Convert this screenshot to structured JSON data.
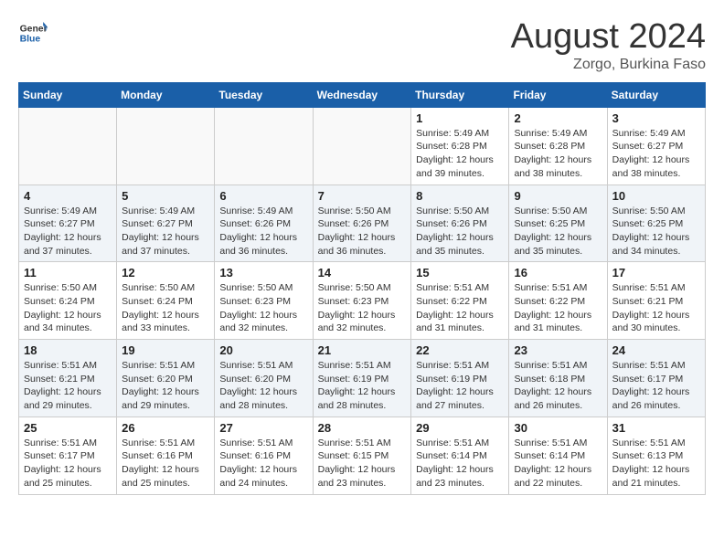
{
  "header": {
    "logo_line1": "General",
    "logo_line2": "Blue",
    "title": "August 2024",
    "location": "Zorgo, Burkina Faso"
  },
  "days_of_week": [
    "Sunday",
    "Monday",
    "Tuesday",
    "Wednesday",
    "Thursday",
    "Friday",
    "Saturday"
  ],
  "weeks": [
    [
      {
        "day": "",
        "info": ""
      },
      {
        "day": "",
        "info": ""
      },
      {
        "day": "",
        "info": ""
      },
      {
        "day": "",
        "info": ""
      },
      {
        "day": "1",
        "info": "Sunrise: 5:49 AM\nSunset: 6:28 PM\nDaylight: 12 hours\nand 39 minutes."
      },
      {
        "day": "2",
        "info": "Sunrise: 5:49 AM\nSunset: 6:28 PM\nDaylight: 12 hours\nand 38 minutes."
      },
      {
        "day": "3",
        "info": "Sunrise: 5:49 AM\nSunset: 6:27 PM\nDaylight: 12 hours\nand 38 minutes."
      }
    ],
    [
      {
        "day": "4",
        "info": "Sunrise: 5:49 AM\nSunset: 6:27 PM\nDaylight: 12 hours\nand 37 minutes."
      },
      {
        "day": "5",
        "info": "Sunrise: 5:49 AM\nSunset: 6:27 PM\nDaylight: 12 hours\nand 37 minutes."
      },
      {
        "day": "6",
        "info": "Sunrise: 5:49 AM\nSunset: 6:26 PM\nDaylight: 12 hours\nand 36 minutes."
      },
      {
        "day": "7",
        "info": "Sunrise: 5:50 AM\nSunset: 6:26 PM\nDaylight: 12 hours\nand 36 minutes."
      },
      {
        "day": "8",
        "info": "Sunrise: 5:50 AM\nSunset: 6:26 PM\nDaylight: 12 hours\nand 35 minutes."
      },
      {
        "day": "9",
        "info": "Sunrise: 5:50 AM\nSunset: 6:25 PM\nDaylight: 12 hours\nand 35 minutes."
      },
      {
        "day": "10",
        "info": "Sunrise: 5:50 AM\nSunset: 6:25 PM\nDaylight: 12 hours\nand 34 minutes."
      }
    ],
    [
      {
        "day": "11",
        "info": "Sunrise: 5:50 AM\nSunset: 6:24 PM\nDaylight: 12 hours\nand 34 minutes."
      },
      {
        "day": "12",
        "info": "Sunrise: 5:50 AM\nSunset: 6:24 PM\nDaylight: 12 hours\nand 33 minutes."
      },
      {
        "day": "13",
        "info": "Sunrise: 5:50 AM\nSunset: 6:23 PM\nDaylight: 12 hours\nand 32 minutes."
      },
      {
        "day": "14",
        "info": "Sunrise: 5:50 AM\nSunset: 6:23 PM\nDaylight: 12 hours\nand 32 minutes."
      },
      {
        "day": "15",
        "info": "Sunrise: 5:51 AM\nSunset: 6:22 PM\nDaylight: 12 hours\nand 31 minutes."
      },
      {
        "day": "16",
        "info": "Sunrise: 5:51 AM\nSunset: 6:22 PM\nDaylight: 12 hours\nand 31 minutes."
      },
      {
        "day": "17",
        "info": "Sunrise: 5:51 AM\nSunset: 6:21 PM\nDaylight: 12 hours\nand 30 minutes."
      }
    ],
    [
      {
        "day": "18",
        "info": "Sunrise: 5:51 AM\nSunset: 6:21 PM\nDaylight: 12 hours\nand 29 minutes."
      },
      {
        "day": "19",
        "info": "Sunrise: 5:51 AM\nSunset: 6:20 PM\nDaylight: 12 hours\nand 29 minutes."
      },
      {
        "day": "20",
        "info": "Sunrise: 5:51 AM\nSunset: 6:20 PM\nDaylight: 12 hours\nand 28 minutes."
      },
      {
        "day": "21",
        "info": "Sunrise: 5:51 AM\nSunset: 6:19 PM\nDaylight: 12 hours\nand 28 minutes."
      },
      {
        "day": "22",
        "info": "Sunrise: 5:51 AM\nSunset: 6:19 PM\nDaylight: 12 hours\nand 27 minutes."
      },
      {
        "day": "23",
        "info": "Sunrise: 5:51 AM\nSunset: 6:18 PM\nDaylight: 12 hours\nand 26 minutes."
      },
      {
        "day": "24",
        "info": "Sunrise: 5:51 AM\nSunset: 6:17 PM\nDaylight: 12 hours\nand 26 minutes."
      }
    ],
    [
      {
        "day": "25",
        "info": "Sunrise: 5:51 AM\nSunset: 6:17 PM\nDaylight: 12 hours\nand 25 minutes."
      },
      {
        "day": "26",
        "info": "Sunrise: 5:51 AM\nSunset: 6:16 PM\nDaylight: 12 hours\nand 25 minutes."
      },
      {
        "day": "27",
        "info": "Sunrise: 5:51 AM\nSunset: 6:16 PM\nDaylight: 12 hours\nand 24 minutes."
      },
      {
        "day": "28",
        "info": "Sunrise: 5:51 AM\nSunset: 6:15 PM\nDaylight: 12 hours\nand 23 minutes."
      },
      {
        "day": "29",
        "info": "Sunrise: 5:51 AM\nSunset: 6:14 PM\nDaylight: 12 hours\nand 23 minutes."
      },
      {
        "day": "30",
        "info": "Sunrise: 5:51 AM\nSunset: 6:14 PM\nDaylight: 12 hours\nand 22 minutes."
      },
      {
        "day": "31",
        "info": "Sunrise: 5:51 AM\nSunset: 6:13 PM\nDaylight: 12 hours\nand 21 minutes."
      }
    ]
  ]
}
